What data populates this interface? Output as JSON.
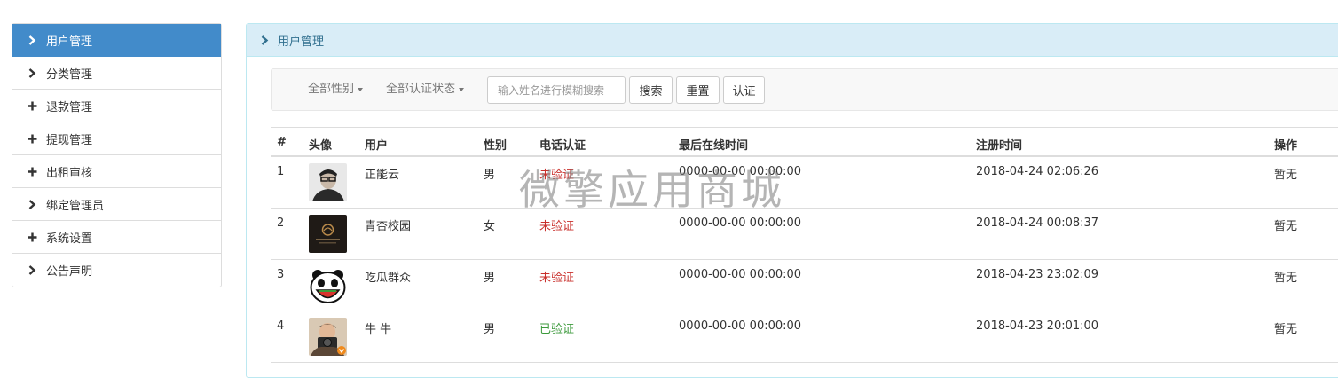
{
  "sidebar": {
    "items": [
      {
        "label": "用户管理",
        "icon": "chevron-right-icon",
        "active": true
      },
      {
        "label": "分类管理",
        "icon": "chevron-right-icon",
        "active": false
      },
      {
        "label": "退款管理",
        "icon": "plus-icon",
        "active": false
      },
      {
        "label": "提现管理",
        "icon": "plus-icon",
        "active": false
      },
      {
        "label": "出租审核",
        "icon": "plus-icon",
        "active": false
      },
      {
        "label": "绑定管理员",
        "icon": "chevron-right-icon",
        "active": false
      },
      {
        "label": "系统设置",
        "icon": "plus-icon",
        "active": false
      },
      {
        "label": "公告声明",
        "icon": "chevron-right-icon",
        "active": false
      }
    ]
  },
  "panel": {
    "title": "用户管理"
  },
  "toolbar": {
    "gender_filter": "全部性别",
    "auth_filter": "全部认证状态",
    "search_placeholder": "输入姓名进行模糊搜索",
    "search_label": "搜索",
    "reset_label": "重置",
    "auth_label": "认证"
  },
  "table": {
    "headers": {
      "index": "#",
      "avatar": "头像",
      "user": "用户",
      "gender": "性别",
      "phone_auth": "电话认证",
      "last_online": "最后在线时间",
      "registered": "注册时间",
      "action": "操作"
    },
    "rows": [
      {
        "index": "1",
        "user": "正能云",
        "gender": "男",
        "phone_auth": "未验证",
        "last_online": "0000-00-00 00:00:00",
        "registered": "2018-04-24 02:06:26",
        "action": "暂无"
      },
      {
        "index": "2",
        "user": "青杏校园",
        "gender": "女",
        "phone_auth": "未验证",
        "last_online": "0000-00-00 00:00:00",
        "registered": "2018-04-24 00:08:37",
        "action": "暂无"
      },
      {
        "index": "3",
        "user": "吃瓜群众",
        "gender": "男",
        "phone_auth": "未验证",
        "last_online": "0000-00-00 00:00:00",
        "registered": "2018-04-23 23:02:09",
        "action": "暂无"
      },
      {
        "index": "4",
        "user": "牛 牛",
        "gender": "男",
        "phone_auth": "已验证",
        "last_online": "0000-00-00 00:00:00",
        "registered": "2018-04-23 20:01:00",
        "action": "暂无"
      }
    ]
  },
  "watermark": "微擎应用商城",
  "colors": {
    "active": "#428bca",
    "unverified": "#c9302c",
    "verified": "#3c9a3c",
    "panel_head": "#d9edf7"
  }
}
